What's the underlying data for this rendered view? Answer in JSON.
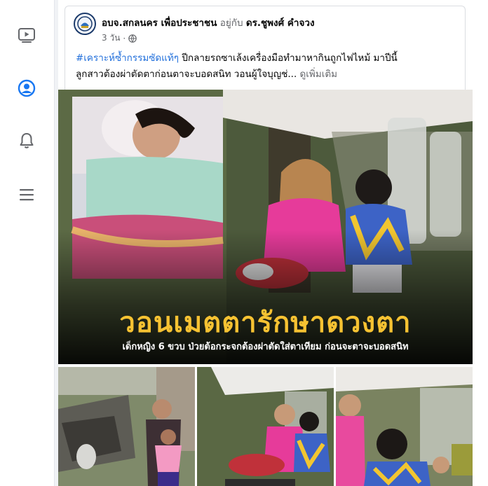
{
  "colors": {
    "accent": "#216fdb",
    "rail_icon_active": "#1877f2",
    "rail_icon": "#65676b",
    "headline": "#f6c232"
  },
  "nav": {
    "items": [
      {
        "name": "watch",
        "icon": "video-icon"
      },
      {
        "name": "profile",
        "icon": "profile-icon",
        "active": true
      },
      {
        "name": "notifications",
        "icon": "bell-icon"
      },
      {
        "name": "menu",
        "icon": "hamburger-menu-icon"
      }
    ]
  },
  "post": {
    "author": "อบจ.สกลนคร เพื่อประชาชน",
    "with_label": "อยู่กับ",
    "with_name": "ดร.ชูพงศ์ คำจวง",
    "time": "3 วัน",
    "privacy_icon": "globe-icon",
    "hashtag": "#เคราะห์ซ้ำกรรมซัดแท้ๆ",
    "text_line1": " ปีกลายรถซาเล้งเครื่องมือทำมาหากินถูกไฟไหม้ มาปีนี้",
    "text_line2": "ลูกสาวต้องผ่าตัดตาก่อนตาจะบอดสนิท  วอนผู้ใจบุญช่...",
    "see_more": " ดูเพิ่มเติม"
  },
  "image": {
    "headline": "วอนเมตตารักษาดวงตา",
    "subline": "เด็กหญิง 6 ขวบ ป่วยต้อกระจกต้องผ่าตัดใส่ตาเทียม ก่อนจะตาจะบอดสนิท"
  }
}
